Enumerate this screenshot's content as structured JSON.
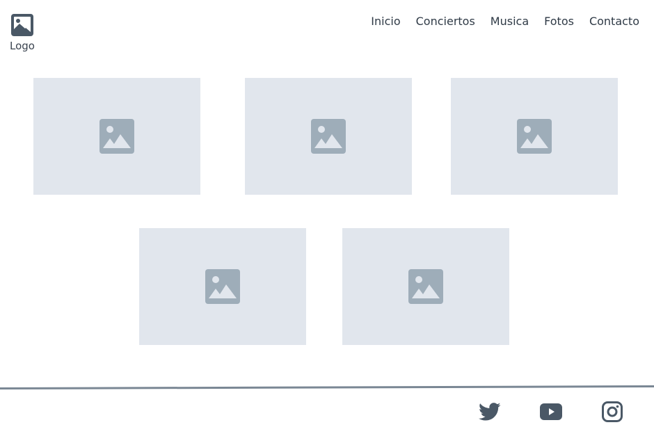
{
  "header": {
    "logo_label": "Logo",
    "logo_icon": "image-icon",
    "nav": [
      {
        "label": "Inicio"
      },
      {
        "label": "Conciertos"
      },
      {
        "label": "Musica"
      },
      {
        "label": "Fotos"
      },
      {
        "label": "Contacto"
      }
    ]
  },
  "gallery": {
    "placeholder_icon": "image-placeholder-icon",
    "tile_count": 5
  },
  "footer": {
    "social": [
      {
        "icon": "twitter-icon"
      },
      {
        "icon": "youtube-icon"
      },
      {
        "icon": "instagram-icon"
      }
    ]
  },
  "colors": {
    "text": "#2f3a46",
    "icon_dark": "#4a5866",
    "tile_bg": "#e1e6ed",
    "placeholder_icon": "#9eadb9",
    "footer_rule": "#7a8794"
  }
}
